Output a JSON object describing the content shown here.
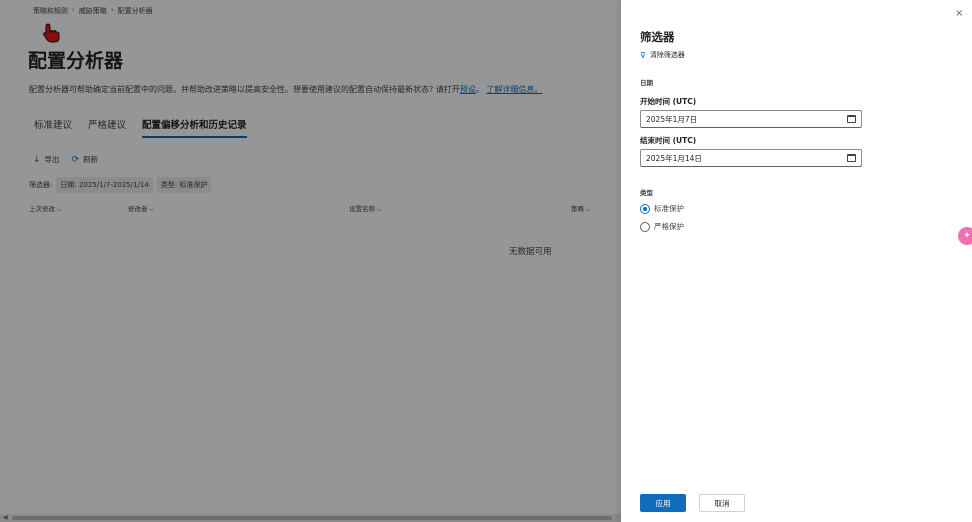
{
  "breadcrumb": [
    "策略和规则",
    "威胁策略",
    "配置分析器"
  ],
  "page": {
    "title": "配置分析器",
    "description": "配置分析器可帮助确定当前配置中的问题，并帮助改进策略以提高安全性。想要使用建议的配置自动保持最新状态? 请打开",
    "link_preset": "预设",
    "link_learn_more": "了解详细信息。",
    "tabs": [
      "标准建议",
      "严格建议",
      "配置偏移分析和历史记录"
    ],
    "toolbar": {
      "export": "导出",
      "refresh": "刷新"
    },
    "filters": {
      "label": "筛选器:",
      "date_chip": "日期: 2025/1/7-2025/1/14",
      "type_chip": "类型: 标准保护"
    },
    "columns": [
      "上次修改",
      "修改者",
      "设置名称",
      "策略"
    ],
    "empty_text": "无数据可用"
  },
  "panel": {
    "title": "筛选器",
    "clear": "清除筛选器",
    "date_section": "日期",
    "start_label": "开始时间 (UTC)",
    "start_value": "2025年1月7日",
    "end_label": "结束时间 (UTC)",
    "end_value": "2025年1月14日",
    "type_section": "类型",
    "options": [
      {
        "label": "标准保护",
        "checked": true
      },
      {
        "label": "严格保护",
        "checked": false
      }
    ],
    "apply": "应用",
    "cancel": "取消",
    "close_icon": "×"
  },
  "colors": {
    "accent": "#0f6cbd",
    "overlay": "rgba(0,0,0,0.40)",
    "edge_button": "#f06fb0"
  },
  "icons": [
    "cursor-hand-icon",
    "download-icon",
    "refresh-icon",
    "filter-clear-icon",
    "calendar-icon",
    "close-icon",
    "radio-selected-icon"
  ]
}
